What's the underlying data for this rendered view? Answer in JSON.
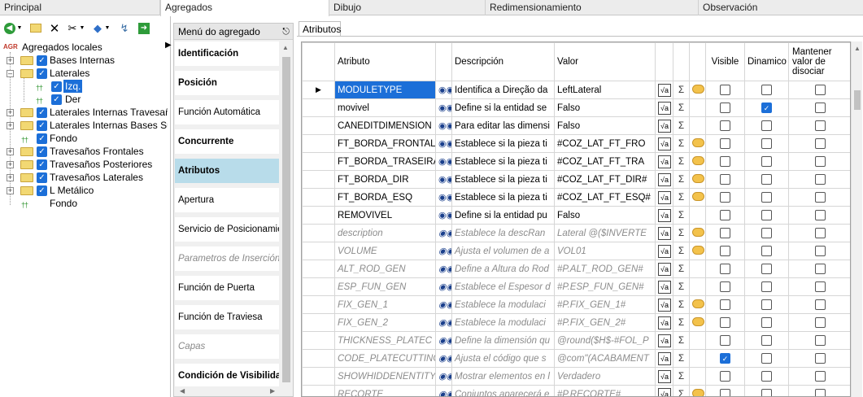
{
  "top_tabs": [
    "Principal",
    "Agregados",
    "Dibujo",
    "Redimensionamiento",
    "Observación"
  ],
  "tree": {
    "root_label": "Agregados locales",
    "root_badge": "AGR",
    "items": [
      {
        "label": "Bases Internas"
      },
      {
        "label": "Laterales"
      },
      {
        "label": "Izq."
      },
      {
        "label": "Der"
      },
      {
        "label": "Laterales Internas Travesañ"
      },
      {
        "label": "Laterales Internas Bases Su"
      },
      {
        "label": "Fondo"
      },
      {
        "label": "Travesaños Frontales"
      },
      {
        "label": "Travesaños Posteriores"
      },
      {
        "label": "Travesaños Laterales"
      },
      {
        "label": "L Metálico"
      },
      {
        "label": "Fondo"
      }
    ]
  },
  "menu": {
    "title": "Menú do agregado",
    "items": [
      {
        "label": "Identificación"
      },
      {
        "label": "Posición"
      },
      {
        "label": "Función Automática"
      },
      {
        "label": "Concurrente"
      },
      {
        "label": "Atributos"
      },
      {
        "label": "Apertura"
      },
      {
        "label": "Servicio de Posicionamie"
      },
      {
        "label": "Parametros de Inserción"
      },
      {
        "label": "Función de Puerta"
      },
      {
        "label": "Función de Traviesa"
      },
      {
        "label": "Capas"
      },
      {
        "label": "Condición de Visibilidad"
      }
    ]
  },
  "attributes_tab": "Atributos",
  "grid": {
    "headers": {
      "attribute": "Atributo",
      "description": "Descripción",
      "value": "Valor",
      "visible": "Visible",
      "dynamic": "Dinamico",
      "keep": "Mantener valor de disociar"
    },
    "rows": [
      {
        "attr": "MODULETYPE",
        "desc": "Identifica a Direção da",
        "value": "LeftLateral",
        "visible": false,
        "dynamic": false,
        "keep": false
      },
      {
        "attr": "movivel",
        "desc": "Define si la entidad se",
        "value": "Falso",
        "visible": false,
        "dynamic": true,
        "keep": false
      },
      {
        "attr": "CANEDITDIMENSION",
        "desc": "Para editar las dimensi",
        "value": "Falso",
        "visible": false,
        "dynamic": false,
        "keep": false
      },
      {
        "attr": "FT_BORDA_FRONTAL",
        "desc": "Establece si la pieza ti",
        "value": "#COZ_LAT_FT_FRO",
        "visible": false,
        "dynamic": false,
        "keep": false
      },
      {
        "attr": "FT_BORDA_TRASEIRA",
        "desc": "Establece si la pieza ti",
        "value": "#COZ_LAT_FT_TRA",
        "visible": false,
        "dynamic": false,
        "keep": false
      },
      {
        "attr": "FT_BORDA_DIR",
        "desc": "Establece si la pieza ti",
        "value": "#COZ_LAT_FT_DIR#",
        "visible": false,
        "dynamic": false,
        "keep": false
      },
      {
        "attr": "FT_BORDA_ESQ",
        "desc": "Establece si la pieza ti",
        "value": "#COZ_LAT_FT_ESQ#",
        "visible": false,
        "dynamic": false,
        "keep": false
      },
      {
        "attr": "REMOVIVEL",
        "desc": "Define si la entidad pu",
        "value": "Falso",
        "visible": false,
        "dynamic": false,
        "keep": false
      },
      {
        "attr": "description",
        "desc": "Establece la descRan",
        "value": "Lateral @($INVERTE",
        "visible": false,
        "dynamic": false,
        "keep": false
      },
      {
        "attr": "VOLUME",
        "desc": "Ajusta el volumen de a",
        "value": "VOL01",
        "visible": false,
        "dynamic": false,
        "keep": false
      },
      {
        "attr": "ALT_ROD_GEN",
        "desc": "Define a Altura do Rod",
        "value": "#P.ALT_ROD_GEN#",
        "visible": false,
        "dynamic": false,
        "keep": false
      },
      {
        "attr": "ESP_FUN_GEN",
        "desc": "Establece el Espesor d",
        "value": "#P.ESP_FUN_GEN#",
        "visible": false,
        "dynamic": false,
        "keep": false
      },
      {
        "attr": "FIX_GEN_1",
        "desc": "Establece la modulaci",
        "value": "#P.FIX_GEN_1#",
        "visible": false,
        "dynamic": false,
        "keep": false
      },
      {
        "attr": "FIX_GEN_2",
        "desc": "Establece la modulaci",
        "value": "#P.FIX_GEN_2#",
        "visible": false,
        "dynamic": false,
        "keep": false
      },
      {
        "attr": "THICKNESS_PLATEC",
        "desc": "Define la dimensión qu",
        "value": "@round($H$-#FOL_P",
        "visible": false,
        "dynamic": false,
        "keep": false
      },
      {
        "attr": "CODE_PLATECUTTING",
        "desc": "Ajusta el código que s",
        "value": "@com\"(ACABAMENT",
        "visible": true,
        "dynamic": false,
        "keep": false
      },
      {
        "attr": "SHOWHIDDENENTITY",
        "desc": "Mostrar elementos en l",
        "value": "Verdadero",
        "visible": false,
        "dynamic": false,
        "keep": false
      },
      {
        "attr": "RECORTE",
        "desc": "Conjuntos aparecerá e",
        "value": "#P.RECORTE#",
        "visible": false,
        "dynamic": false,
        "keep": false
      }
    ]
  }
}
